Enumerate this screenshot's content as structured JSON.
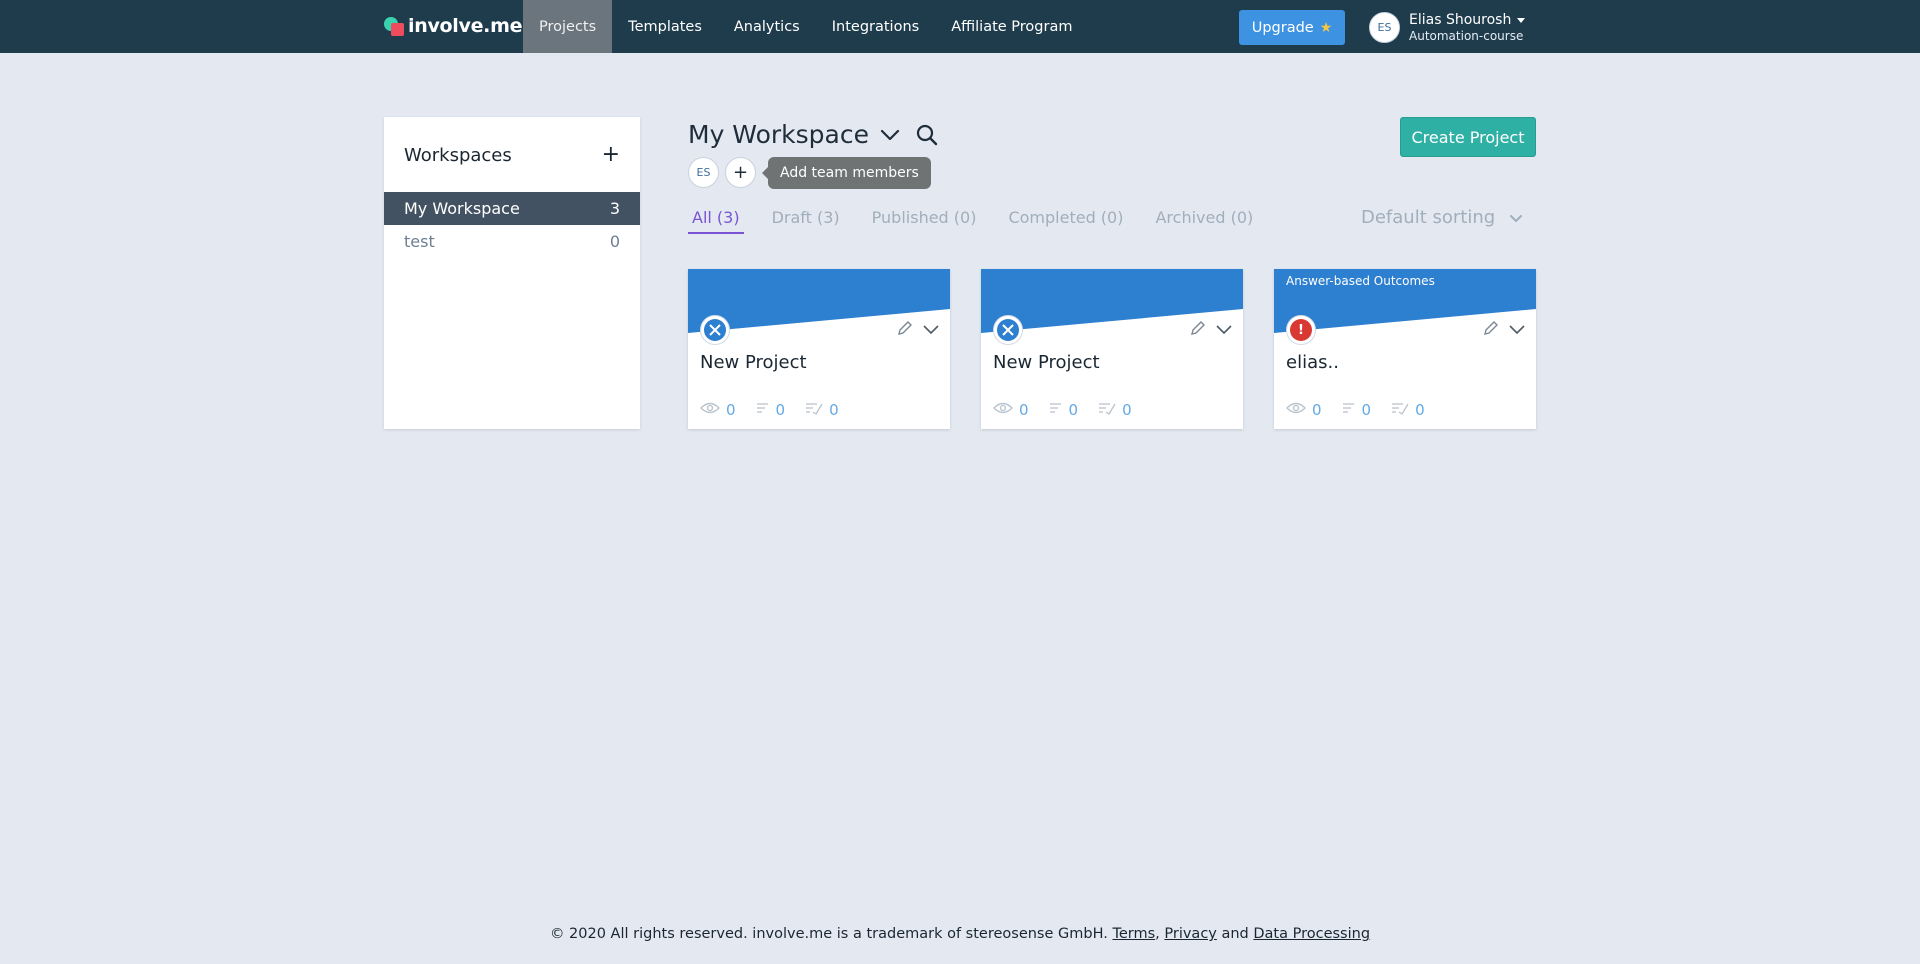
{
  "nav": {
    "brand": "involve.me",
    "links": [
      "Projects",
      "Templates",
      "Analytics",
      "Integrations",
      "Affiliate Program"
    ],
    "active_link": "Projects",
    "upgrade_label": "Upgrade",
    "user": {
      "initials": "ES",
      "name": "Elias Shourosh",
      "organization": "Automation-course"
    }
  },
  "sidebar": {
    "title": "Workspaces",
    "add_symbol": "+",
    "workspaces": [
      {
        "name": "My Workspace",
        "count": "3",
        "active": true
      },
      {
        "name": "test",
        "count": "0",
        "active": false
      }
    ]
  },
  "main": {
    "workspace_title": "My Workspace",
    "create_button": "Create Project",
    "team": {
      "member_initials": "ES",
      "add_symbol": "+",
      "tooltip": "Add team members"
    },
    "tabs": [
      {
        "label": "All (3)",
        "active": true
      },
      {
        "label": "Draft (3)",
        "active": false
      },
      {
        "label": "Published (0)",
        "active": false
      },
      {
        "label": "Completed (0)",
        "active": false
      },
      {
        "label": "Archived (0)",
        "active": false
      }
    ],
    "sorting": "Default sorting"
  },
  "projects": [
    {
      "title": "New Project",
      "label": "",
      "icon": "wrench-ruler-icon",
      "views": "0",
      "starts": "0",
      "submissions": "0"
    },
    {
      "title": "New Project",
      "label": "",
      "icon": "wrench-ruler-icon",
      "views": "0",
      "starts": "0",
      "submissions": "0"
    },
    {
      "title": "elias..",
      "label": "Answer-based Outcomes",
      "icon": "exclamation-icon",
      "views": "0",
      "starts": "0",
      "submissions": "0"
    }
  ],
  "footer": {
    "text": "© 2020 All rights reserved. involve.me is a trademark of stereosense GmbH.",
    "terms": "Terms",
    "comma": ",",
    "privacy": "Privacy",
    "and": "and",
    "data_processing": "Data Processing"
  },
  "colors": {
    "nav_bg": "#1f3c4d",
    "accent_purple": "#7a54d4",
    "create_green": "#2fb0a4",
    "card_blue": "#2d7fd0",
    "stat_blue": "#64a8e6",
    "alert_red": "#d83a33"
  }
}
